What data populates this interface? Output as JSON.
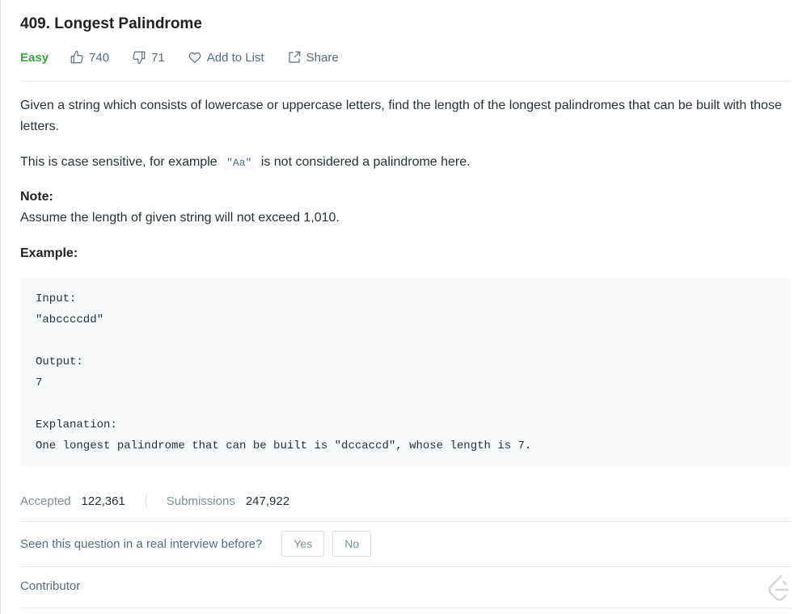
{
  "problem": {
    "title": "409. Longest Palindrome",
    "difficulty": "Easy",
    "likes": "740",
    "dislikes": "71",
    "add_to_list": "Add to List",
    "share": "Share"
  },
  "description": {
    "paragraph1": "Given a string which consists of lowercase or uppercase letters, find the length of the longest palindromes that can be built with those letters.",
    "paragraph2_before": "This is case sensitive, for example",
    "paragraph2_code": "\"Aa\"",
    "paragraph2_after": "is not considered a palindrome here.",
    "note_heading": "Note:",
    "note_text": "Assume the length of given string will not exceed 1,010.",
    "example_heading": "Example:"
  },
  "example_block": {
    "lines": [
      "Input:",
      "\"abccccdd\"",
      "",
      "Output:",
      "7",
      "",
      "Explanation:",
      "One longest palindrome that can be built is \"dccaccd\", whose length is 7."
    ]
  },
  "stats": {
    "accepted_label": "Accepted",
    "accepted_value": "122,361",
    "submissions_label": "Submissions",
    "submissions_value": "247,922"
  },
  "interview": {
    "question": "Seen this question in a real interview before?",
    "yes": "Yes",
    "no": "No"
  },
  "contributor_label": "Contributor",
  "colors": {
    "easy": "#43a047",
    "text": "#263238",
    "muted": "#546e7a",
    "code_bg": "#f7f9fa"
  }
}
